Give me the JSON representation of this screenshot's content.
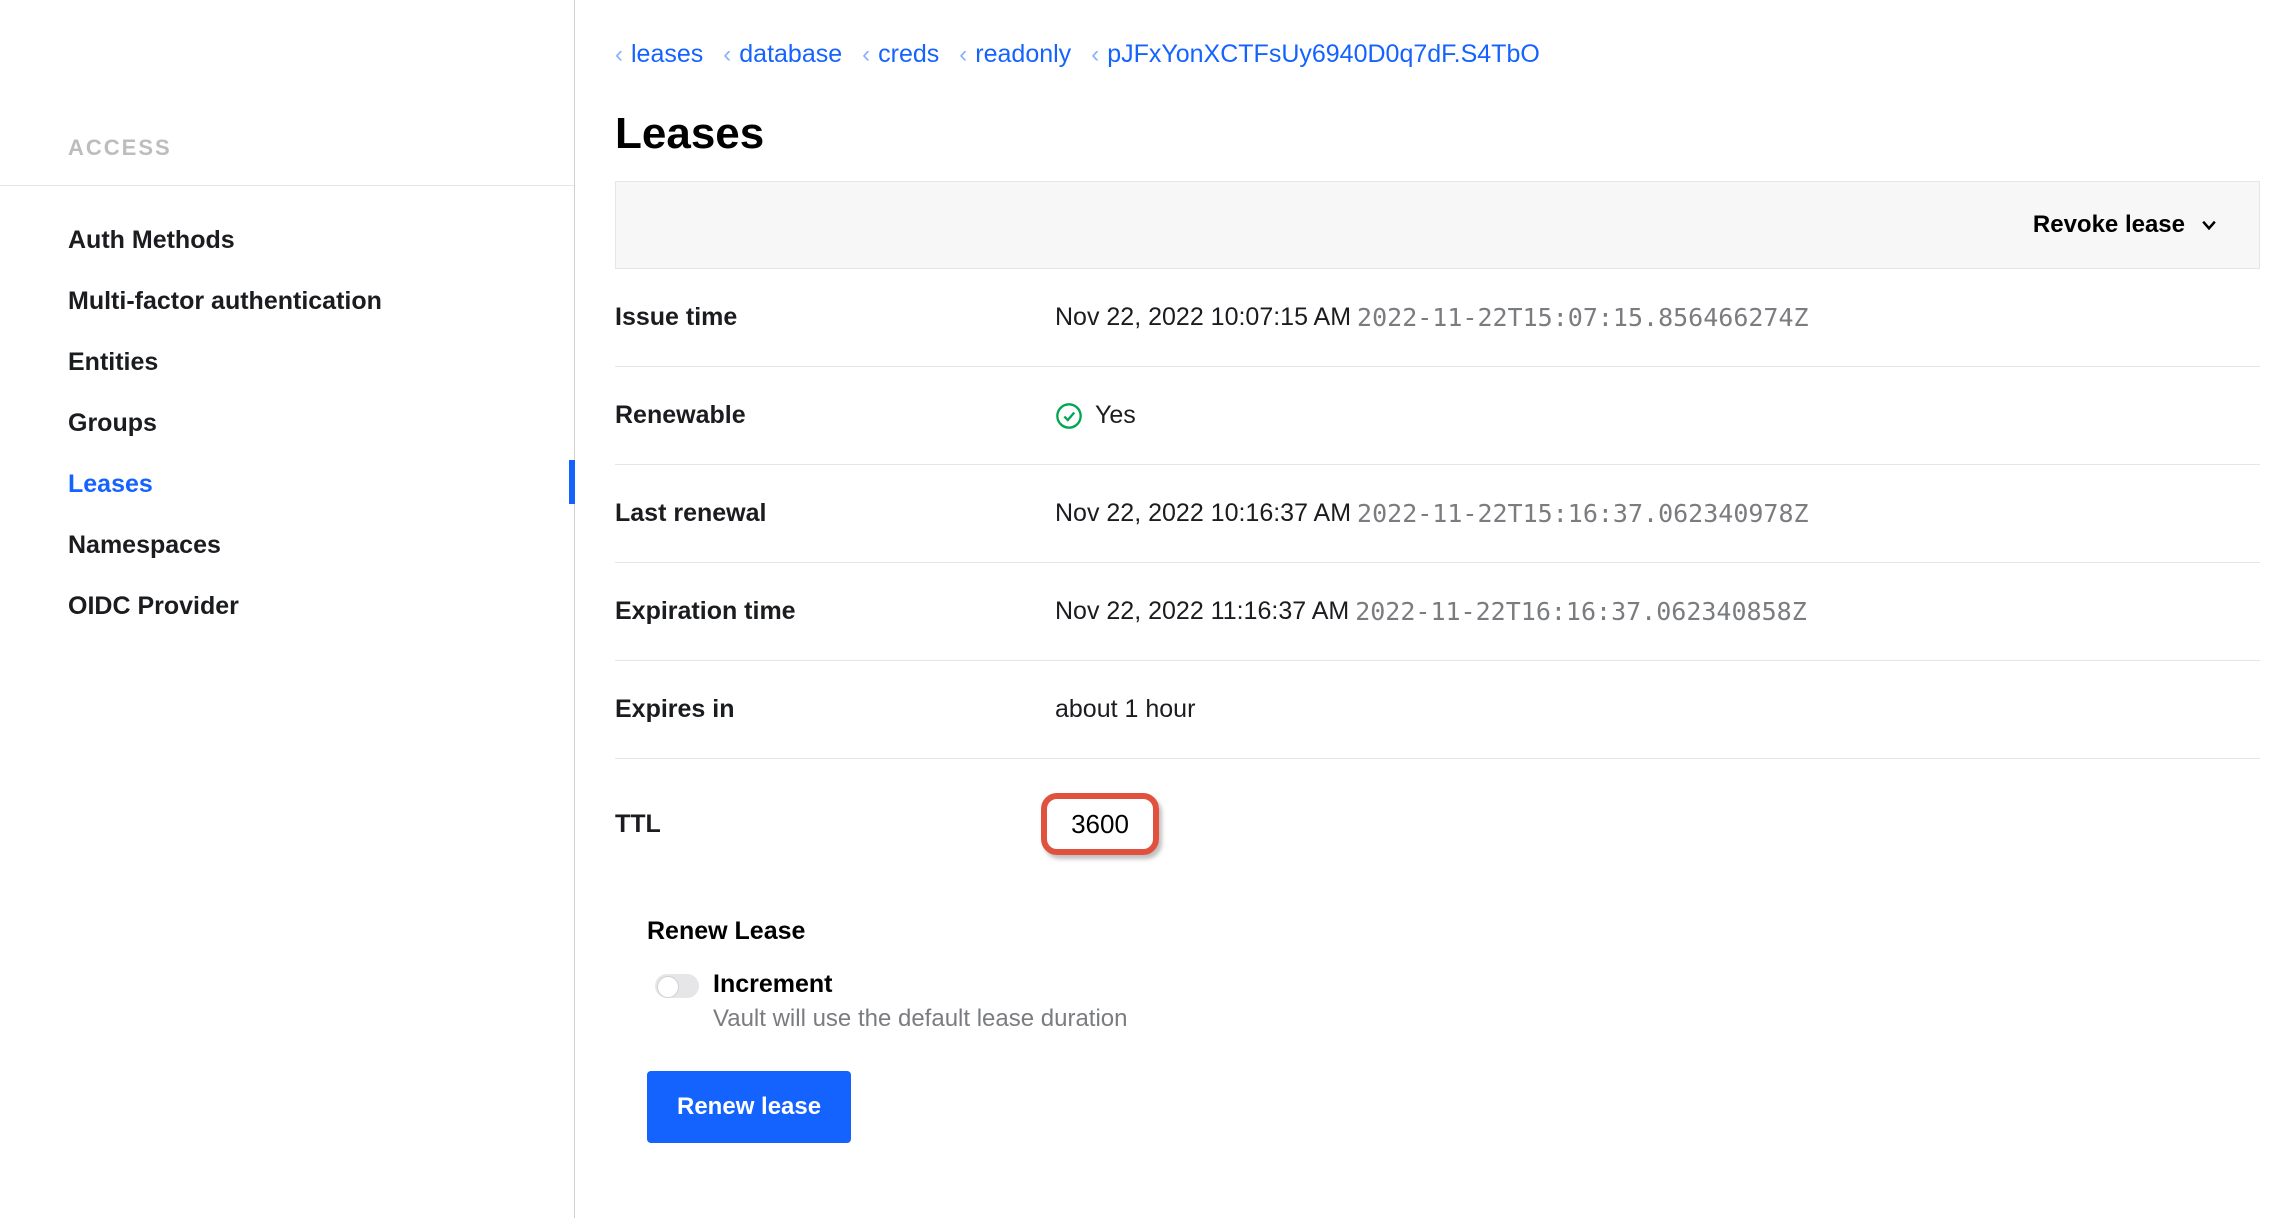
{
  "sidebar": {
    "heading": "ACCESS",
    "items": [
      {
        "label": "Auth Methods",
        "active": false
      },
      {
        "label": "Multi-factor authentication",
        "active": false
      },
      {
        "label": "Entities",
        "active": false
      },
      {
        "label": "Groups",
        "active": false
      },
      {
        "label": "Leases",
        "active": true
      },
      {
        "label": "Namespaces",
        "active": false
      },
      {
        "label": "OIDC Provider",
        "active": false
      }
    ]
  },
  "breadcrumb": [
    "leases",
    "database",
    "creds",
    "readonly",
    "pJFxYonXCTFsUy6940D0q7dF.S4TbO"
  ],
  "page_title": "Leases",
  "toolbar": {
    "revoke_label": "Revoke lease"
  },
  "details": {
    "issue_time": {
      "label": "Issue time",
      "human": "Nov 22, 2022 10:07:15 AM",
      "iso": "2022-11-22T15:07:15.856466274Z"
    },
    "renewable": {
      "label": "Renewable",
      "value": "Yes"
    },
    "last_renewal": {
      "label": "Last renewal",
      "human": "Nov 22, 2022 10:16:37 AM",
      "iso": "2022-11-22T15:16:37.062340978Z"
    },
    "expiration": {
      "label": "Expiration time",
      "human": "Nov 22, 2022 11:16:37 AM",
      "iso": "2022-11-22T16:16:37.062340858Z"
    },
    "expires_in": {
      "label": "Expires in",
      "value": "about 1 hour"
    },
    "ttl": {
      "label": "TTL",
      "value": "3600"
    }
  },
  "renew": {
    "title": "Renew Lease",
    "increment_label": "Increment",
    "increment_help": "Vault will use the default lease duration",
    "button": "Renew lease"
  }
}
